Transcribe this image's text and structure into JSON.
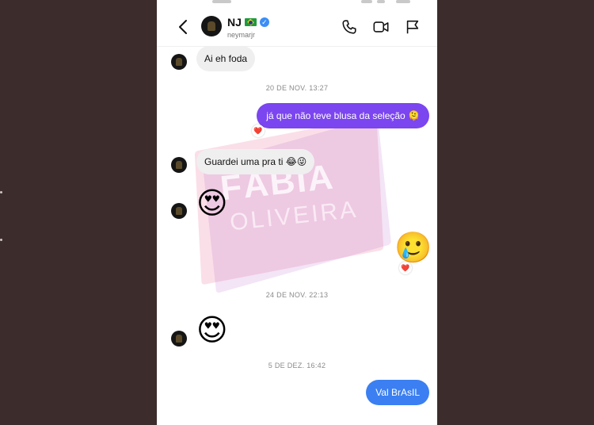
{
  "colors": {
    "background": "#3d2c2c",
    "outgoing_purple": "#7b45f0",
    "outgoing_blue": "#3b7ff2",
    "incoming": "#efefef"
  },
  "header": {
    "name": "NJ",
    "flag": "🇧🇷",
    "verified_icon": "✓",
    "handle": "neymarjr",
    "icons": [
      "back-arrow-icon",
      "phone-icon",
      "video-icon",
      "flag-icon"
    ]
  },
  "watermark": {
    "line1": "FÁBIA",
    "line2": "OLIVEIRA"
  },
  "messages": [
    {
      "text": "Ai eh foda"
    },
    {
      "timestamp": "20 DE NOV. 13:27"
    },
    {
      "text": "já que não teve blusa da seleção 🫠",
      "reaction": "❤️"
    },
    {
      "text": "Guardei uma pra ti 😂😜"
    },
    {
      "emoji": "😍"
    },
    {
      "emoji": "🥲",
      "reaction": "❤️"
    },
    {
      "timestamp": "24 DE NOV. 22:13"
    },
    {
      "emoji": "😍"
    },
    {
      "timestamp": "5 DE DEZ. 16:42"
    },
    {
      "text": "Val BrAsIL"
    }
  ]
}
